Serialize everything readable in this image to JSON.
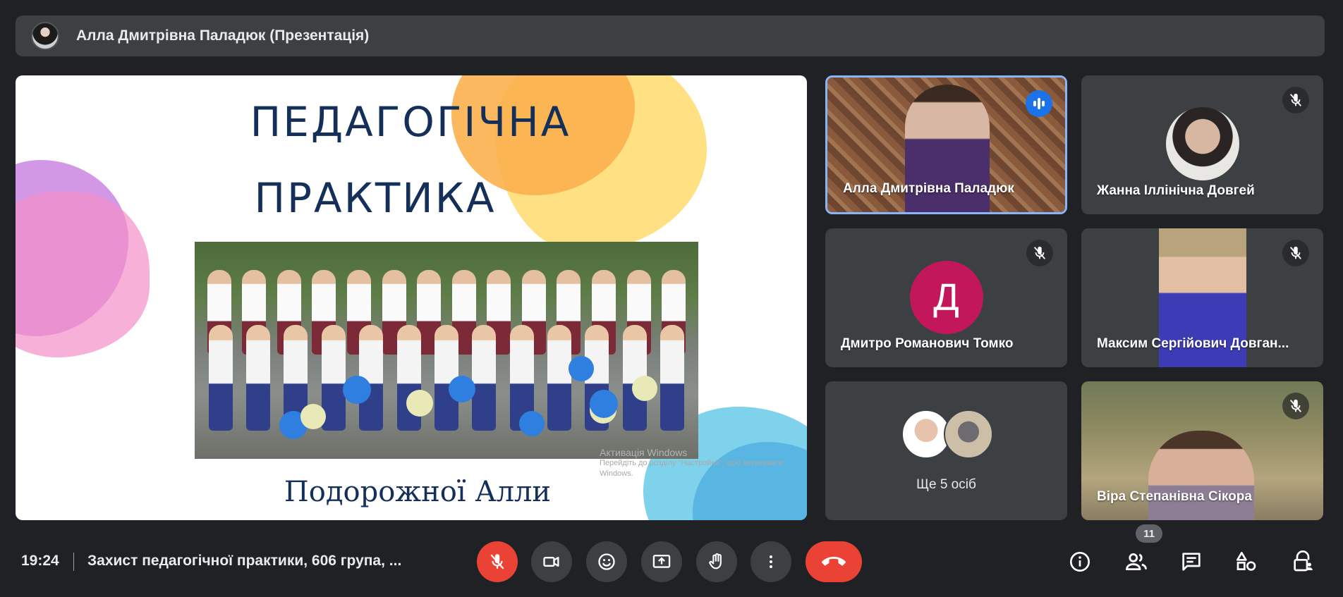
{
  "top_bar": {
    "presenter_title": "Алла Дмитрівна Паладюк (Презентація)"
  },
  "slide": {
    "title_line1": "ПЕДАГОГІЧНА",
    "title_line2": "ПРАКТИКА",
    "subtitle": "Подорожної Алли",
    "watermark_title": "Активація Windows",
    "watermark_text1": "Перейдіть до розділу \"Настройки\", щоб активувати",
    "watermark_text2": "Windows."
  },
  "tiles": [
    {
      "name": "Алла Дмитрівна Паладюк",
      "status": "speaking"
    },
    {
      "name": "Жанна Іллінічна Довгей",
      "status": "muted"
    },
    {
      "name": "Дмитро Романович Томко",
      "initial": "Д",
      "status": "muted"
    },
    {
      "name": "Максим Сергійович Довган...",
      "status": "muted"
    },
    {
      "more_label": "Ще 5 осіб"
    },
    {
      "name": "Віра Степанівна Сікора",
      "status": "muted"
    }
  ],
  "bottom_bar": {
    "time": "19:24",
    "meeting_title": "Захист педагогічної практики, 606 група, ...",
    "participants_count": "11"
  },
  "colors": {
    "background": "#202124",
    "surface": "#3c4043",
    "danger": "#ea4335",
    "active_border": "#8ab4f8",
    "speaking": "#1a73e8",
    "avatar_letter_bg": "#c2185b",
    "slide_text": "#14305a"
  },
  "icons": {
    "mic_off": "mic-off-icon",
    "camera": "camera-icon",
    "emoji": "emoji-icon",
    "present": "present-screen-icon",
    "hand": "raise-hand-icon",
    "more": "more-vert-icon",
    "leave": "call-end-icon",
    "info": "info-icon",
    "people": "people-icon",
    "chat": "chat-icon",
    "activities": "activities-icon",
    "host_controls": "lock-person-icon"
  }
}
